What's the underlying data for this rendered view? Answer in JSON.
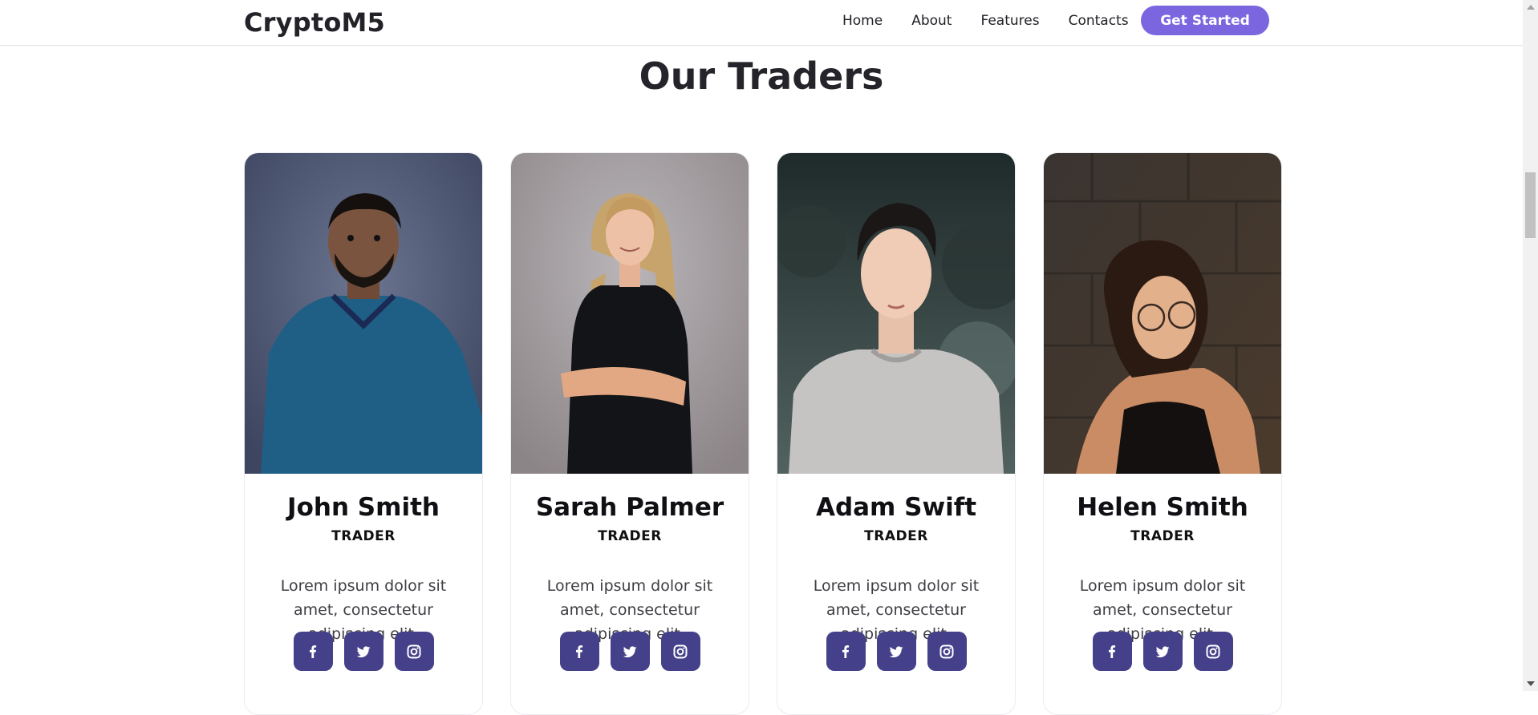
{
  "nav": {
    "brand": "CryptoM5",
    "links": [
      "Home",
      "About",
      "Features",
      "Contacts"
    ],
    "cta": "Get Started",
    "cta_color": "#7b66e0"
  },
  "section": {
    "title": "Our Traders"
  },
  "traders": [
    {
      "name": "John Smith",
      "role": "TRADER",
      "bio": "Lorem ipsum dolor sit amet, consectetur adipiscing elit."
    },
    {
      "name": "Sarah Palmer",
      "role": "TRADER",
      "bio": "Lorem ipsum dolor sit amet, consectetur adipiscing elit."
    },
    {
      "name": "Adam Swift",
      "role": "TRADER",
      "bio": "Lorem ipsum dolor sit amet, consectetur adipiscing elit."
    },
    {
      "name": "Helen Smith",
      "role": "TRADER",
      "bio": "Lorem ipsum dolor sit amet, consectetur adipiscing elit."
    }
  ],
  "social_icons": [
    "facebook-icon",
    "twitter-icon",
    "instagram-icon"
  ],
  "colors": {
    "social_button": "#44408a",
    "accent": "#7b66e0"
  }
}
